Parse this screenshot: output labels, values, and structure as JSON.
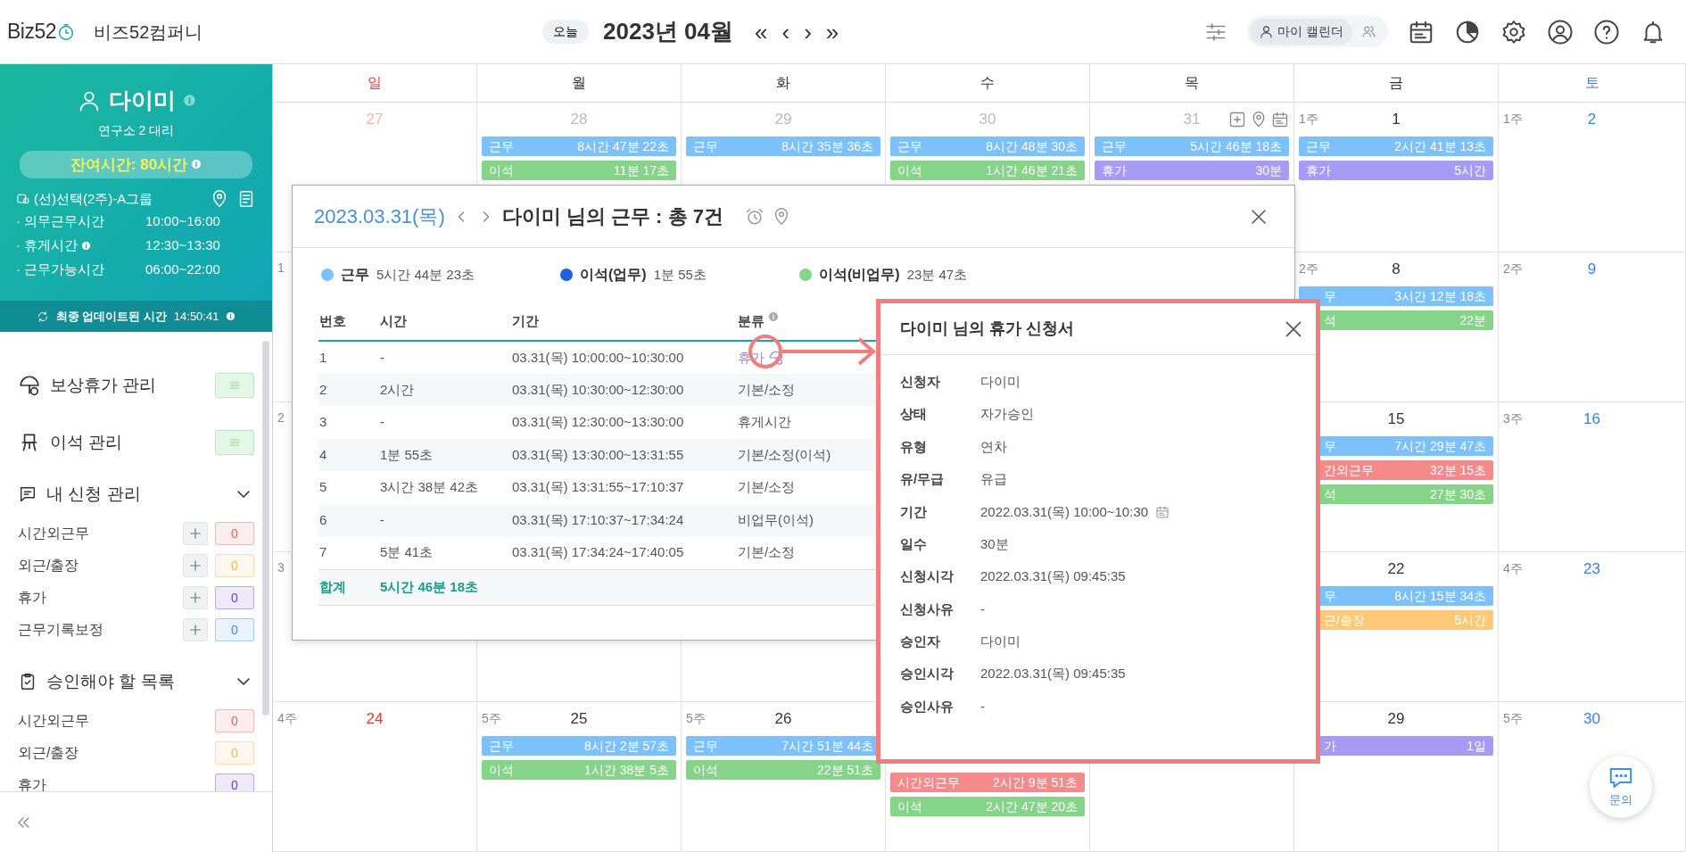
{
  "header": {
    "logo": "Biz52",
    "company": "비즈52컴퍼니",
    "today_button": "오늘",
    "month": "2023년 04월",
    "nav": [
      "«",
      "‹",
      "›",
      "»"
    ],
    "view_toggle": [
      {
        "kind": "person",
        "label": "마이 캘린더",
        "selected": true
      },
      {
        "kind": "group",
        "selected": false
      }
    ]
  },
  "sidebar": {
    "profile": {
      "name": "다이미",
      "position": "연구소 2 대리",
      "remaining": "잔여시간: 80시간",
      "group": "(선)선택(2주)-A그룹",
      "schedule": [
        {
          "label": "· 의무근무시간",
          "time": "10:00~16:00",
          "info": false
        },
        {
          "label": "· 휴게시간",
          "time": "12:30~13:30",
          "info": true
        },
        {
          "label": "· 근무가능시간",
          "time": "06:00~22:00",
          "info": false
        }
      ],
      "update_label": "최종 업데이트된 시간",
      "update_time": "14:50:41"
    },
    "menus": [
      {
        "kind": "link",
        "label": "보상휴가 관리"
      },
      {
        "kind": "link",
        "label": "이석 관리"
      },
      {
        "kind": "section",
        "label": "내 신청 관리",
        "expanded": true,
        "items": [
          {
            "label": "시간외근무",
            "count": "0",
            "color": "#e86363",
            "addable": true
          },
          {
            "label": "외근/출장",
            "count": "0",
            "color": "#f3b45a",
            "addable": true
          },
          {
            "label": "휴가",
            "count": "0",
            "color": "#6b40c9",
            "addable": true
          },
          {
            "label": "근무기록보정",
            "count": "0",
            "color": "#3d8fe0",
            "addable": true
          }
        ]
      },
      {
        "kind": "section",
        "label": "승인해야 할 목록",
        "expanded": true,
        "items": [
          {
            "label": "시간외근무",
            "count": "0",
            "color": "#e86363",
            "addable": false
          },
          {
            "label": "외근/출장",
            "count": "0",
            "color": "#f3b45a",
            "addable": false
          },
          {
            "label": "휴가",
            "count": "0",
            "color": "#6b40c9",
            "addable": false
          }
        ]
      }
    ]
  },
  "calendar": {
    "weekdays": [
      "일",
      "월",
      "화",
      "수",
      "목",
      "금",
      "토"
    ],
    "weeks": [
      {
        "sun": {
          "date": "27",
          "muted": true
        },
        "mon": {
          "date": "28",
          "muted": true,
          "events": [
            {
              "kind": "work",
              "label": "근무",
              "value": "8시간 47분 22초"
            },
            {
              "kind": "away",
              "label": "이석",
              "value": "11분 17초"
            }
          ]
        },
        "tue": {
          "date": "29",
          "muted": true,
          "events": [
            {
              "kind": "work",
              "label": "근무",
              "value": "8시간 35분 36초"
            }
          ]
        },
        "wed": {
          "date": "30",
          "muted": true,
          "events": [
            {
              "kind": "work",
              "label": "근무",
              "value": "8시간 48분 30초"
            },
            {
              "kind": "away",
              "label": "이석",
              "value": "1시간 46분 21초"
            }
          ]
        },
        "thu": {
          "date": "31",
          "muted": true,
          "tools": true,
          "events": [
            {
              "kind": "work",
              "label": "근무",
              "value": "5시간 46분 18초"
            },
            {
              "kind": "leave",
              "label": "휴가",
              "value": "30분"
            }
          ]
        },
        "fri": {
          "week_label": "1주",
          "date": "1",
          "muted": false,
          "events": [
            {
              "kind": "work",
              "label": "근무",
              "value": "2시간 41분 13초"
            },
            {
              "kind": "leave",
              "label": "휴가",
              "value": "5시간"
            }
          ]
        },
        "sat": {
          "week_label": "1주",
          "date": "2",
          "muted": false
        }
      },
      {
        "sun": {
          "week_label": "1"
        },
        "fri": {
          "week_label": "2주",
          "date": "8",
          "muted": false,
          "covered_left": true,
          "events": [
            {
              "kind": "work",
              "label": "무",
              "value": "3시간 12분 18초"
            },
            {
              "kind": "away",
              "label": "석",
              "value": "22분"
            }
          ]
        },
        "sat": {
          "week_label": "2주",
          "date": "9",
          "muted": false
        }
      },
      {
        "sun": {
          "week_label": "2"
        },
        "fri": {
          "date": "15",
          "muted": false,
          "covered_left": true,
          "events": [
            {
              "kind": "work",
              "label": "무",
              "value": "7시간 29분 47초"
            },
            {
              "kind": "overtime",
              "label": "간외근무",
              "value": "32분 15초"
            },
            {
              "kind": "away",
              "label": "석",
              "value": "27분 30초"
            }
          ]
        },
        "sat": {
          "week_label": "3주",
          "date": "16",
          "muted": false
        }
      },
      {
        "sun": {
          "week_label": "3"
        },
        "fri": {
          "date": "22",
          "muted": false,
          "covered_left": true,
          "events": [
            {
              "kind": "work",
              "label": "무",
              "value": "8시간 15분 34초"
            },
            {
              "kind": "outside",
              "label": "근/출장",
              "value": "5시간"
            }
          ]
        },
        "sat": {
          "week_label": "4주",
          "date": "23",
          "muted": false
        }
      },
      {
        "sun": {
          "week_label": "4주",
          "date": "24",
          "muted": false
        },
        "mon": {
          "week_label": "5주",
          "date": "25",
          "muted": false,
          "events": [
            {
              "kind": "work",
              "label": "근무",
              "value": "8시간 2분 57초"
            },
            {
              "kind": "away",
              "label": "이석",
              "value": "1시간 38분 5초"
            }
          ]
        },
        "tue": {
          "week_label": "5주",
          "date": "26",
          "muted": false,
          "events": [
            {
              "kind": "work",
              "label": "근무",
              "value": "7시간 51분 44초"
            },
            {
              "kind": "away",
              "label": "이석",
              "value": "22분 51초"
            }
          ]
        },
        "wed": {
          "covered_top": true,
          "events": [
            {
              "kind": "overtime",
              "label": "시간외근무",
              "value": "2시간 9분 51초"
            },
            {
              "kind": "away",
              "label": "이석",
              "value": "2시간 47분 20초"
            }
          ]
        },
        "fri": {
          "date": "29",
          "muted": false,
          "covered_left": true,
          "events": [
            {
              "kind": "leave",
              "label": "가",
              "value": "1일"
            }
          ]
        },
        "sat": {
          "week_label": "5주",
          "date": "30",
          "muted": false
        }
      }
    ]
  },
  "work_popup": {
    "date": "2023.03.31(목)",
    "title": "다이미 님의 근무 : 총 7건",
    "legend": [
      {
        "label": "근무",
        "value": "5시간 44분 23초",
        "color": "#7cc1fb"
      },
      {
        "label": "이석(업무)",
        "value": "1분 55초",
        "color": "#1f62e0"
      },
      {
        "label": "이석(비업무)",
        "value": "23분 47초",
        "color": "#86d489"
      }
    ],
    "columns": [
      {
        "label": "번호",
        "info": false
      },
      {
        "label": "시간",
        "info": false
      },
      {
        "label": "기간",
        "info": false
      },
      {
        "label": "분류",
        "info": true
      }
    ],
    "rows": [
      {
        "no": "1",
        "time": "-",
        "period": "03.31(목) 10:00:00~10:30:00",
        "category": "휴가",
        "kind": "leave"
      },
      {
        "no": "2",
        "time": "2시간",
        "period": "03.31(목) 10:30:00~12:30:00",
        "category": "기본/소정",
        "kind": "normal"
      },
      {
        "no": "3",
        "time": "-",
        "period": "03.31(목) 12:30:00~13:30:00",
        "category": "휴게시간",
        "kind": "normal"
      },
      {
        "no": "4",
        "time": "1분 55초",
        "period": "03.31(목) 13:30:00~13:31:55",
        "category": "기본/소정(이석)",
        "kind": "normal"
      },
      {
        "no": "5",
        "time": "3시간 38분 42초",
        "period": "03.31(목) 13:31:55~17:10:37",
        "category": "기본/소정",
        "kind": "normal"
      },
      {
        "no": "6",
        "time": "-",
        "period": "03.31(목) 17:10:37~17:34:24",
        "category": "비업무(이석)",
        "kind": "normal"
      },
      {
        "no": "7",
        "time": "5분 41초",
        "period": "03.31(목) 17:34:24~17:40:05",
        "category": "기본/소정",
        "kind": "normal"
      }
    ],
    "total_label": "합계",
    "total": "5시간 46분 18초"
  },
  "leave_popup": {
    "title": "다이미 님의 휴가 신청서",
    "fields": [
      {
        "label": "신청자",
        "value": "다이미"
      },
      {
        "label": "상태",
        "value": "자가승인"
      },
      {
        "label": "유형",
        "value": "연차"
      },
      {
        "label": "유/무급",
        "value": "유급"
      },
      {
        "label": "기간",
        "value": "2022.03.31(목) 10:00~10:30",
        "calendar": true
      },
      {
        "label": "일수",
        "value": "30분"
      },
      {
        "label": "신청시각",
        "value": "2022.03.31(목) 09:45:35"
      },
      {
        "label": "신청사유",
        "value": "-"
      },
      {
        "label": "승인자",
        "value": "다이미"
      },
      {
        "label": "승인시각",
        "value": "2022.03.31(목) 09:45:35"
      },
      {
        "label": "승인사유",
        "value": "-"
      }
    ]
  },
  "chat_button": "문의"
}
